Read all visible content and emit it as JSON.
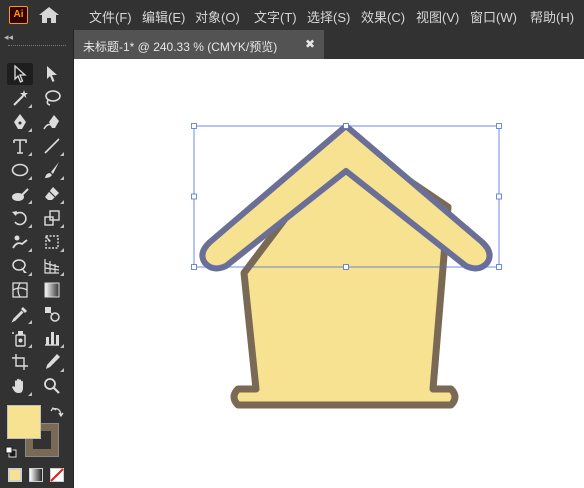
{
  "app": {
    "logo_text": "Ai"
  },
  "menu": {
    "items": [
      {
        "label": "文件(F)"
      },
      {
        "label": "编辑(E)"
      },
      {
        "label": "对象(O)"
      },
      {
        "label": "文字(T)"
      },
      {
        "label": "选择(S)"
      },
      {
        "label": "效果(C)"
      },
      {
        "label": "视图(V)"
      },
      {
        "label": "窗口(W)"
      },
      {
        "label": "帮助(H)"
      }
    ]
  },
  "toolbar": {
    "collapse_glyph": "◂◂"
  },
  "document": {
    "tab_title": "未标题-1* @ 240.33 % (CMYK/预览)",
    "close_glyph": "✖"
  },
  "colors": {
    "fill": "#f6e290",
    "stroke": "#7a6a55",
    "selected_stroke": "#6b6f96",
    "selection_box": "#4d6fd8",
    "ui_dark": "#323232",
    "ui_mid": "#535353"
  },
  "swatches": {
    "fill": "#f6e290",
    "stroke": "#7a6a55"
  }
}
